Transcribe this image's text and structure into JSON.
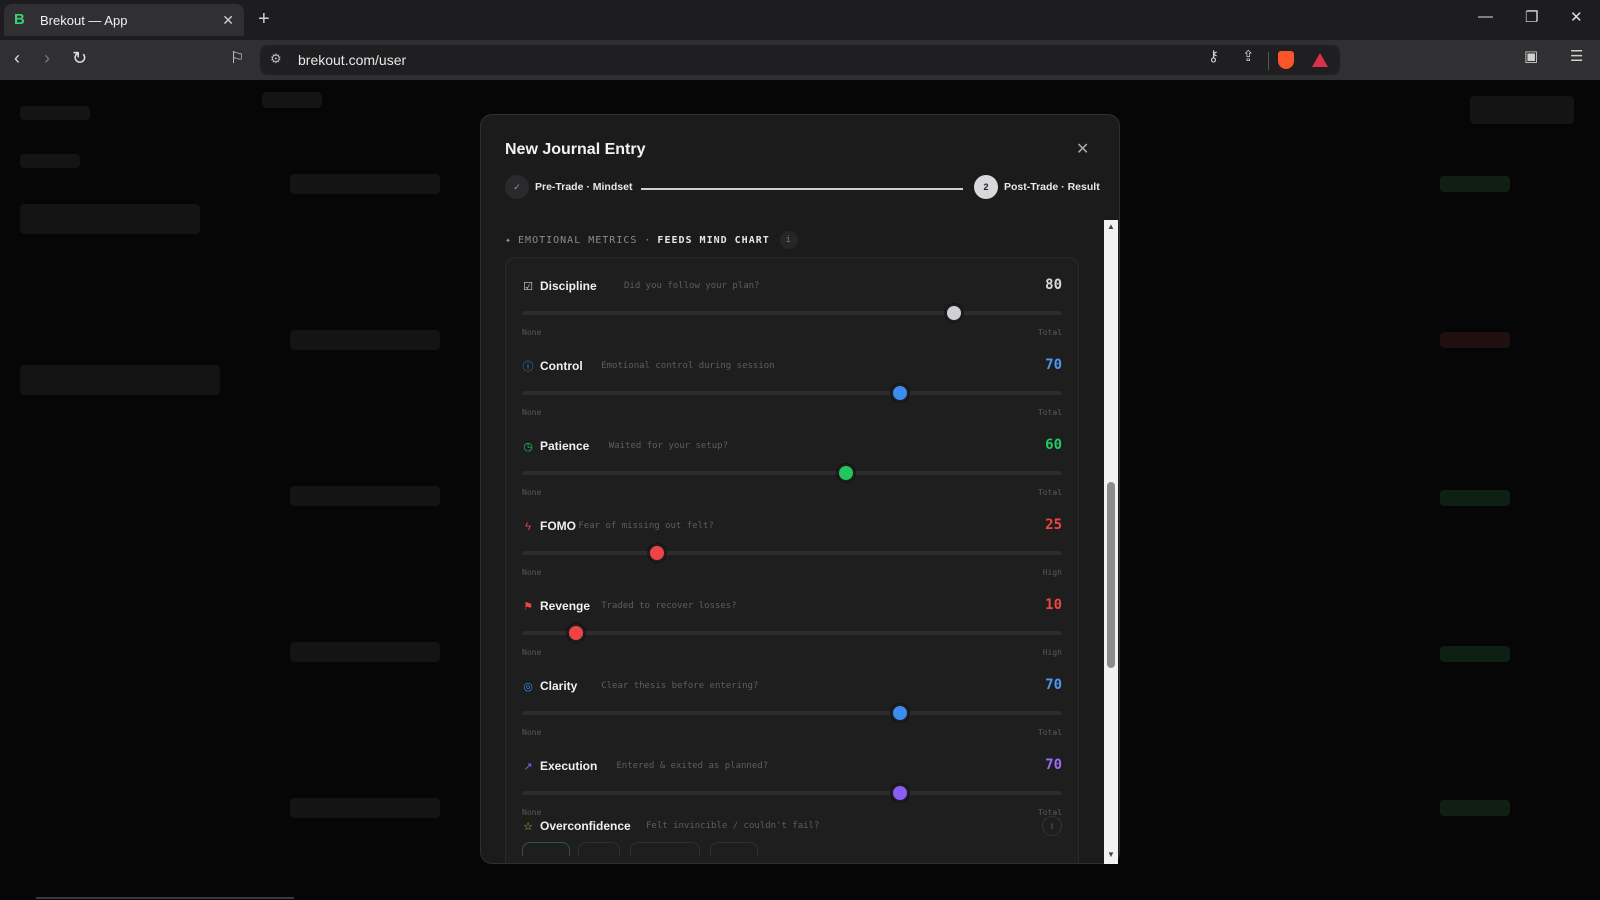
{
  "browser": {
    "tab_title": "Brekout — App",
    "tab_favicon": "B",
    "url": "brekout.com/user",
    "new_tab_icon": "+",
    "tab_close_icon": "✕"
  },
  "modal": {
    "title": "New Journal Entry",
    "close_icon": "✕",
    "steps": [
      {
        "marker": "✓",
        "label": "Pre-Trade · Mindset",
        "state": "done"
      },
      {
        "marker": "2",
        "label": "Post-Trade · Result",
        "state": "active"
      }
    ],
    "section": {
      "icon": "✦",
      "label": "EMOTIONAL METRICS ·",
      "label_bold": "FEEDS MIND CHART",
      "info_icon": "i"
    },
    "metrics": [
      {
        "name": "Discipline",
        "desc": "Did you follow your plan?",
        "value": "80",
        "value_num": 80,
        "min_label": "None",
        "max_label": "Total",
        "color": "#cfd0d4",
        "value_color": "#d9d9d9",
        "icon": "checkbox-icon",
        "glyph": "☑"
      },
      {
        "name": "Control",
        "desc": "Emotional control during session",
        "value": "70",
        "value_num": 70,
        "min_label": "None",
        "max_label": "Total",
        "color": "#3b8cf0",
        "value_color": "#4a97f2",
        "icon": "info-circle-icon",
        "glyph": "ⓘ"
      },
      {
        "name": "Patience",
        "desc": "Waited for your setup?",
        "value": "60",
        "value_num": 60,
        "min_label": "None",
        "max_label": "Total",
        "color": "#22c55e",
        "value_color": "#27c865",
        "icon": "clock-icon",
        "glyph": "◷"
      },
      {
        "name": "FOMO",
        "desc": "Fear of missing out felt?",
        "value": "25",
        "value_num": 25,
        "min_label": "None",
        "max_label": "High",
        "color": "#ef4444",
        "value_color": "#ef4444",
        "icon": "lightning-icon",
        "glyph": "ϟ"
      },
      {
        "name": "Revenge",
        "desc": "Traded to recover losses?",
        "value": "10",
        "value_num": 10,
        "min_label": "None",
        "max_label": "High",
        "color": "#ef4444",
        "value_color": "#ef4444",
        "icon": "flag-icon",
        "glyph": "⚑"
      },
      {
        "name": "Clarity",
        "desc": "Clear thesis before entering?",
        "value": "70",
        "value_num": 70,
        "min_label": "None",
        "max_label": "Total",
        "color": "#3b8cf0",
        "value_color": "#4a97f2",
        "icon": "target-icon",
        "glyph": "◎"
      },
      {
        "name": "Execution",
        "desc": "Entered & exited as planned?",
        "value": "70",
        "value_num": 70,
        "min_label": "None",
        "max_label": "Total",
        "color": "#8b5cf6",
        "value_color": "#9b6cf7",
        "icon": "trending-up-icon",
        "glyph": "↗"
      }
    ],
    "overconfidence": {
      "name": "Overconfidence",
      "desc": "Felt invincible / couldn't fail?",
      "icon": "star-icon",
      "glyph": "☆",
      "info_icon": "i"
    }
  }
}
